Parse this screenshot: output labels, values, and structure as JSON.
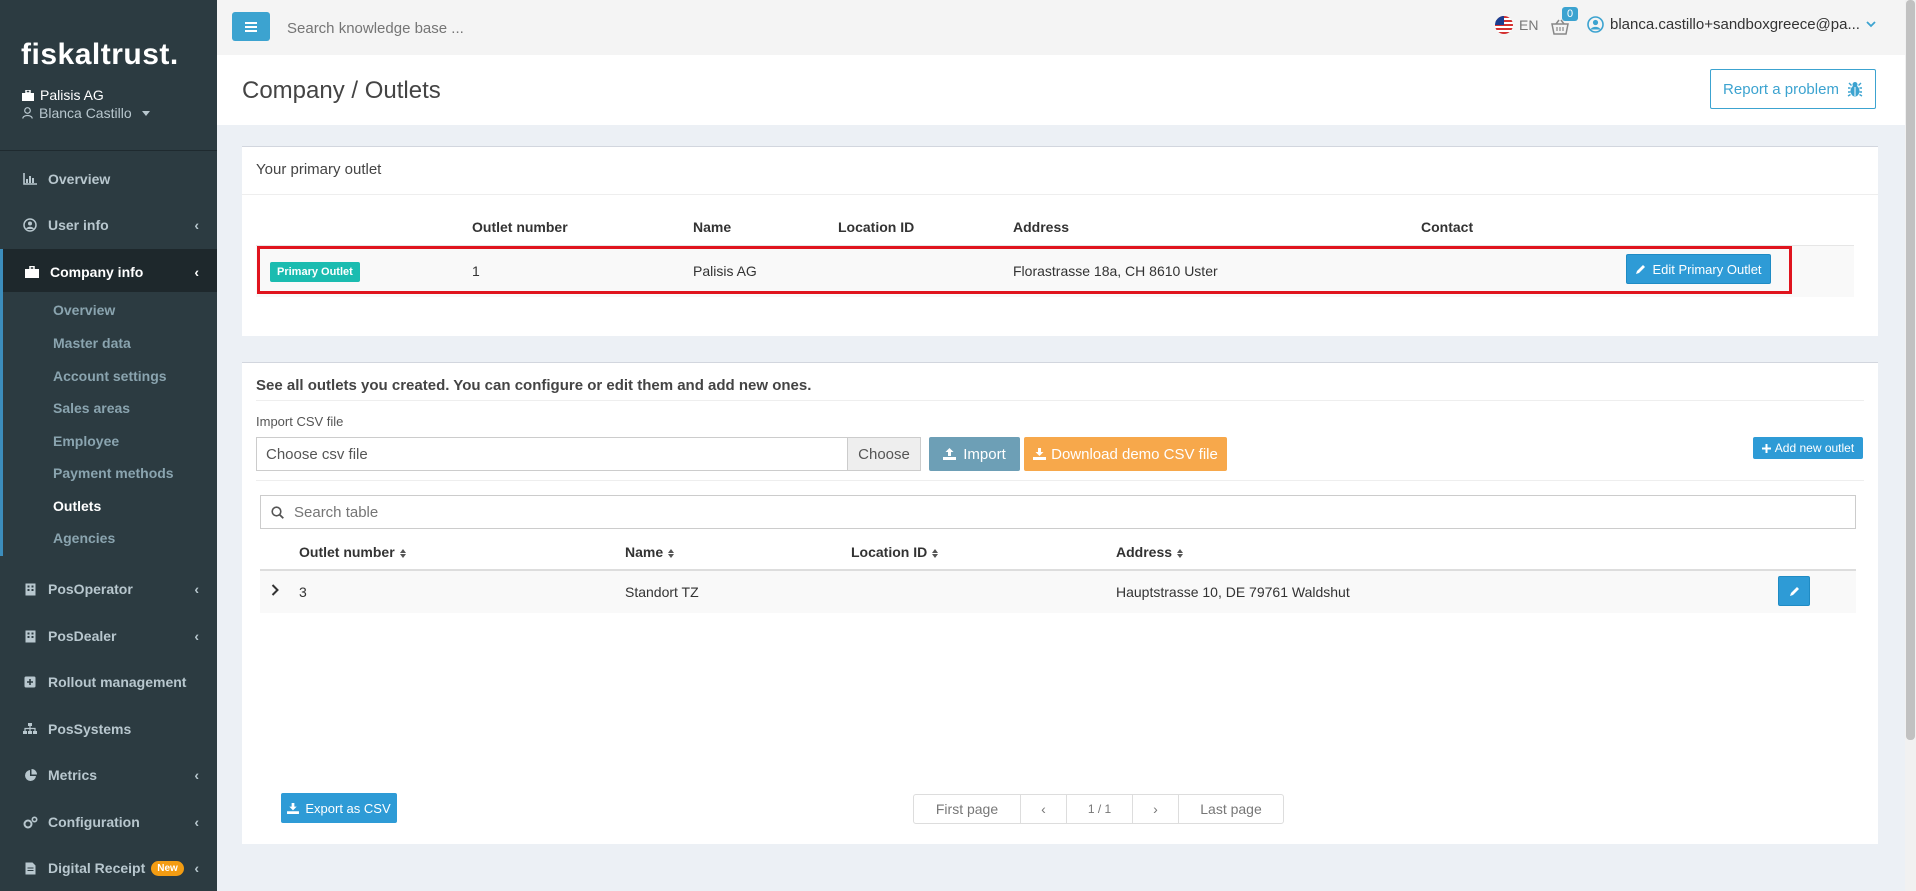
{
  "app": {
    "brand": "fiskaltrust.",
    "company": "Palisis AG",
    "user": "Blanca Castillo"
  },
  "sidebar": {
    "items": [
      {
        "label": "Overview",
        "icon": "bar-chart-icon"
      },
      {
        "label": "User info",
        "icon": "user-circle-icon"
      },
      {
        "label": "Company info",
        "icon": "briefcase-icon"
      },
      {
        "label": "PosOperator",
        "icon": "building-icon"
      },
      {
        "label": "PosDealer",
        "icon": "building-icon"
      },
      {
        "label": "Rollout management",
        "icon": "plus-square-icon"
      },
      {
        "label": "PosSystems",
        "icon": "sitemap-icon"
      },
      {
        "label": "Metrics",
        "icon": "pie-chart-icon"
      },
      {
        "label": "Configuration",
        "icon": "gears-icon"
      },
      {
        "label": "Digital Receipt",
        "icon": "file-icon",
        "badge": "New"
      }
    ],
    "company_sub": [
      {
        "label": "Overview"
      },
      {
        "label": "Master data"
      },
      {
        "label": "Account settings"
      },
      {
        "label": "Sales areas"
      },
      {
        "label": "Employee"
      },
      {
        "label": "Payment methods"
      },
      {
        "label": "Outlets"
      },
      {
        "label": "Agencies"
      }
    ]
  },
  "topbar": {
    "search_placeholder": "Search knowledge base ...",
    "language": "EN",
    "cart_count": "0",
    "user_email": "blanca.castillo+sandboxgreece@pa..."
  },
  "page": {
    "title": "Company / Outlets",
    "report_label": "Report a problem"
  },
  "primary": {
    "title": "Your primary outlet",
    "headers": [
      "Outlet number",
      "Name",
      "Location ID",
      "Address",
      "Contact"
    ],
    "badge": "Primary Outlet",
    "outlet_number": "1",
    "name": "Palisis AG",
    "location_id": "",
    "address": "Florastrasse 18a, CH 8610 Uster",
    "contact": "",
    "edit_label": "Edit Primary Outlet"
  },
  "outlets": {
    "title": "See all outlets you created. You can configure or edit them and add new ones.",
    "import_label": "Import CSV file",
    "file_placeholder": "Choose csv file",
    "choose_label": "Choose",
    "import_button": "Import",
    "download_button": "Download demo CSV file",
    "add_button": "Add new outlet",
    "search_placeholder": "Search table",
    "headers": [
      "Outlet number",
      "Name",
      "Location ID",
      "Address"
    ],
    "rows": [
      {
        "outlet_number": "3",
        "name": "Standort TZ",
        "location_id": "",
        "address": "Hauptstrasse 10, DE 79761 Waldshut"
      }
    ],
    "export_label": "Export as CSV",
    "pagination": {
      "first": "First page",
      "prev": "‹",
      "current": "1 / 1",
      "next": "›",
      "last": "Last page"
    }
  },
  "colors": {
    "sidebar_bg": "#2c3b41",
    "accent": "#3ca3d0",
    "primary_badge": "#1bbcb0",
    "highlight": "#e0141e",
    "download": "#f7a84b"
  }
}
